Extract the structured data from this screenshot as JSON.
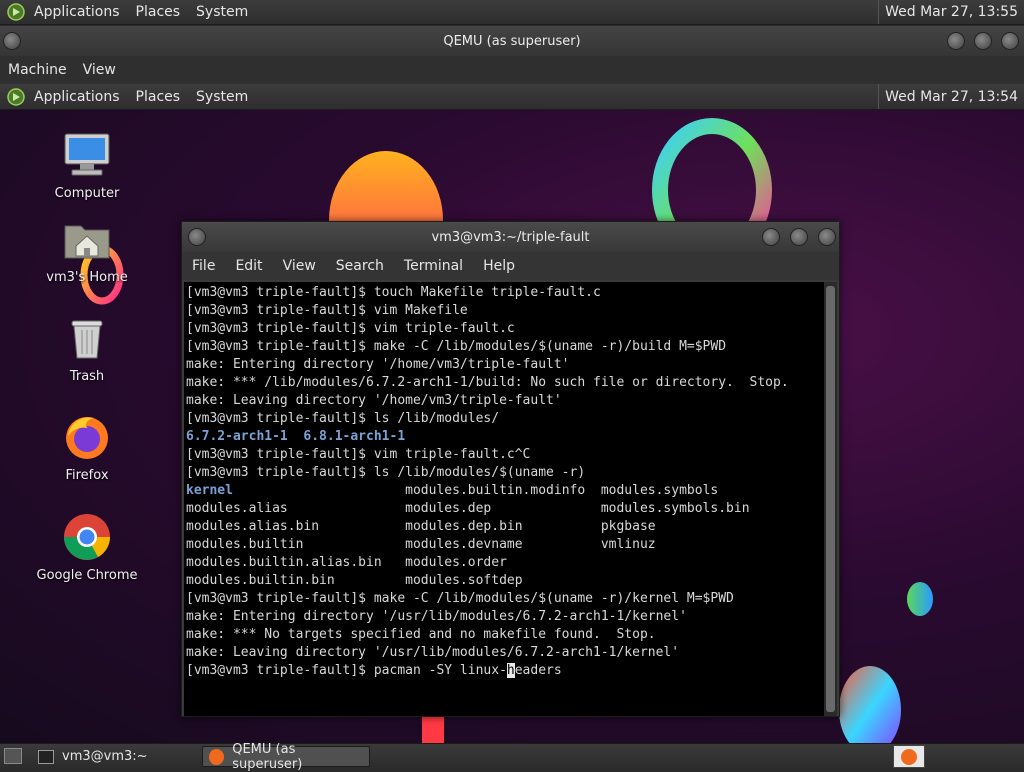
{
  "host_panel": {
    "menus": [
      "Applications",
      "Places",
      "System"
    ],
    "clock": "Wed Mar 27, 13:55"
  },
  "qemu": {
    "title": "QEMU (as superuser)",
    "menus": [
      "Machine",
      "View"
    ]
  },
  "guest_panel": {
    "menus": [
      "Applications",
      "Places",
      "System"
    ],
    "clock": "Wed Mar 27, 13:54"
  },
  "desktop_icons": [
    {
      "label": "Computer",
      "icon": "computer-icon"
    },
    {
      "label": "vm3's Home",
      "icon": "home-folder-icon"
    },
    {
      "label": "Trash",
      "icon": "trash-icon"
    },
    {
      "label": "Firefox",
      "icon": "firefox-icon"
    },
    {
      "label": "Google Chrome",
      "icon": "chrome-icon"
    }
  ],
  "terminal": {
    "title": "vm3@vm3:~/triple-fault",
    "menus": [
      "File",
      "Edit",
      "View",
      "Search",
      "Terminal",
      "Help"
    ],
    "lines": [
      "[vm3@vm3 triple-fault]$ touch Makefile triple-fault.c",
      "[vm3@vm3 triple-fault]$ vim Makefile",
      "[vm3@vm3 triple-fault]$ vim triple-fault.c",
      "[vm3@vm3 triple-fault]$ make -C /lib/modules/$(uname -r)/build M=$PWD",
      "make: Entering directory '/home/vm3/triple-fault'",
      "make: *** /lib/modules/6.7.2-arch1-1/build: No such file or directory.  Stop.",
      "make: Leaving directory '/home/vm3/triple-fault'",
      "[vm3@vm3 triple-fault]$ ls /lib/modules/",
      "6.7.2-arch1-1  6.8.1-arch1-1",
      "[vm3@vm3 triple-fault]$ vim triple-fault.c^C",
      "[vm3@vm3 triple-fault]$ ls /lib/modules/$(uname -r)",
      "kernel                      modules.builtin.modinfo  modules.symbols",
      "modules.alias               modules.dep              modules.symbols.bin",
      "modules.alias.bin           modules.dep.bin          pkgbase",
      "modules.builtin             modules.devname          vmlinuz",
      "modules.builtin.alias.bin   modules.order",
      "modules.builtin.bin         modules.softdep",
      "[vm3@vm3 triple-fault]$ make -C /lib/modules/$(uname -r)/kernel M=$PWD",
      "make: Entering directory '/usr/lib/modules/6.7.2-arch1-1/kernel'",
      "make: *** No targets specified and no makefile found.  Stop.",
      "make: Leaving directory '/usr/lib/modules/6.7.2-arch1-1/kernel'"
    ],
    "prompt_before_cursor": "[vm3@vm3 triple-fault]$ pacman -SY linux-",
    "cursor_char": "h",
    "prompt_after_cursor": "eaders"
  },
  "taskbar": {
    "tasks": [
      "vm3@vm3:~",
      "QEMU (as superuser)"
    ]
  },
  "colors": {
    "accent_blue": "#7aa2d6",
    "terminal_bg": "#000000"
  }
}
